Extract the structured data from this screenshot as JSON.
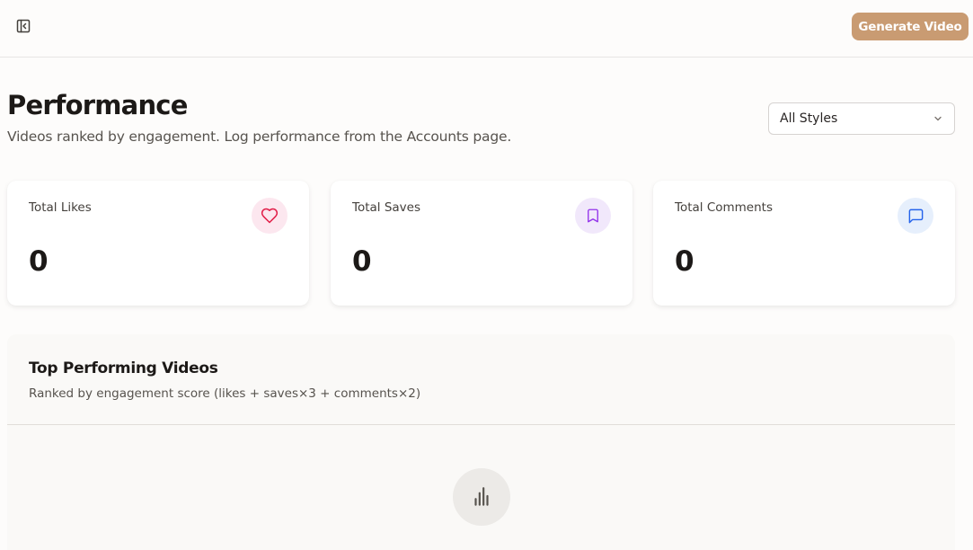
{
  "header": {
    "toggle_icon": "panel-left-close-icon",
    "generate_label": "Generate Video",
    "accent": "#c99b72"
  },
  "page": {
    "title": "Performance",
    "subtitle": "Videos ranked by engagement. Log performance from the Accounts page."
  },
  "filter": {
    "selected": "All Styles",
    "icon": "chevron-down-icon"
  },
  "stats": [
    {
      "label": "Total Likes",
      "value": "0",
      "icon": "heart-icon",
      "color": "#e11d48",
      "bg": "#fce7ef"
    },
    {
      "label": "Total Saves",
      "value": "0",
      "icon": "bookmark-icon",
      "color": "#9333ea",
      "bg": "#f1e8fb"
    },
    {
      "label": "Total Comments",
      "value": "0",
      "icon": "message-square-icon",
      "color": "#2563eb",
      "bg": "#e6effc"
    }
  ],
  "top_videos": {
    "title": "Top Performing Videos",
    "subtitle": "Ranked by engagement score (likes + saves×3 + comments×2)",
    "empty_icon": "bar-chart-icon"
  }
}
